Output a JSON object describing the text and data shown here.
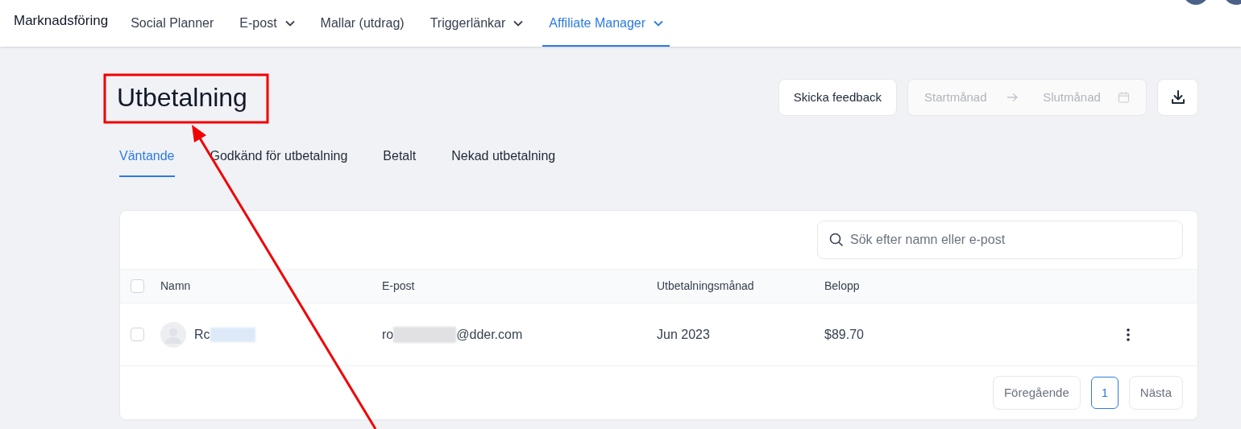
{
  "nav": {
    "brand": "Marknadsföring",
    "items": [
      {
        "label": "Social Planner",
        "dropdown": false,
        "selected": false
      },
      {
        "label": "E-post",
        "dropdown": true,
        "selected": false
      },
      {
        "label": "Mallar (utdrag)",
        "dropdown": false,
        "selected": false
      },
      {
        "label": "Triggerlänkar",
        "dropdown": true,
        "selected": false
      },
      {
        "label": "Affiliate Manager",
        "dropdown": true,
        "selected": true
      }
    ]
  },
  "page": {
    "title": "Utbetalning",
    "feedback_button": "Skicka feedback",
    "date_range": {
      "start_placeholder": "Startmånad",
      "end_placeholder": "Slutmånad"
    }
  },
  "tabs": [
    {
      "label": "Väntande",
      "selected": true
    },
    {
      "label": "Godkänd för utbetalning",
      "selected": false
    },
    {
      "label": "Betalt",
      "selected": false
    },
    {
      "label": "Nekad utbetalning",
      "selected": false
    }
  ],
  "table": {
    "search": {
      "placeholder": "Sök efter namn eller e-post"
    },
    "columns": [
      "Namn",
      "E-post",
      "Utbetalningsmånad",
      "Belopp"
    ],
    "header_checked": false,
    "rows": [
      {
        "checked": false,
        "name": "Rc",
        "email_start": "ro",
        "email_end": "@dder.com",
        "month": "Jun 2023",
        "amount": "$89.70"
      }
    ]
  },
  "pagination": {
    "previous": "Föregående",
    "pages": [
      {
        "label": "1",
        "selected": true
      }
    ],
    "next": "Nästa"
  },
  "annotation": {
    "highlight_box": true,
    "arrow": true
  }
}
